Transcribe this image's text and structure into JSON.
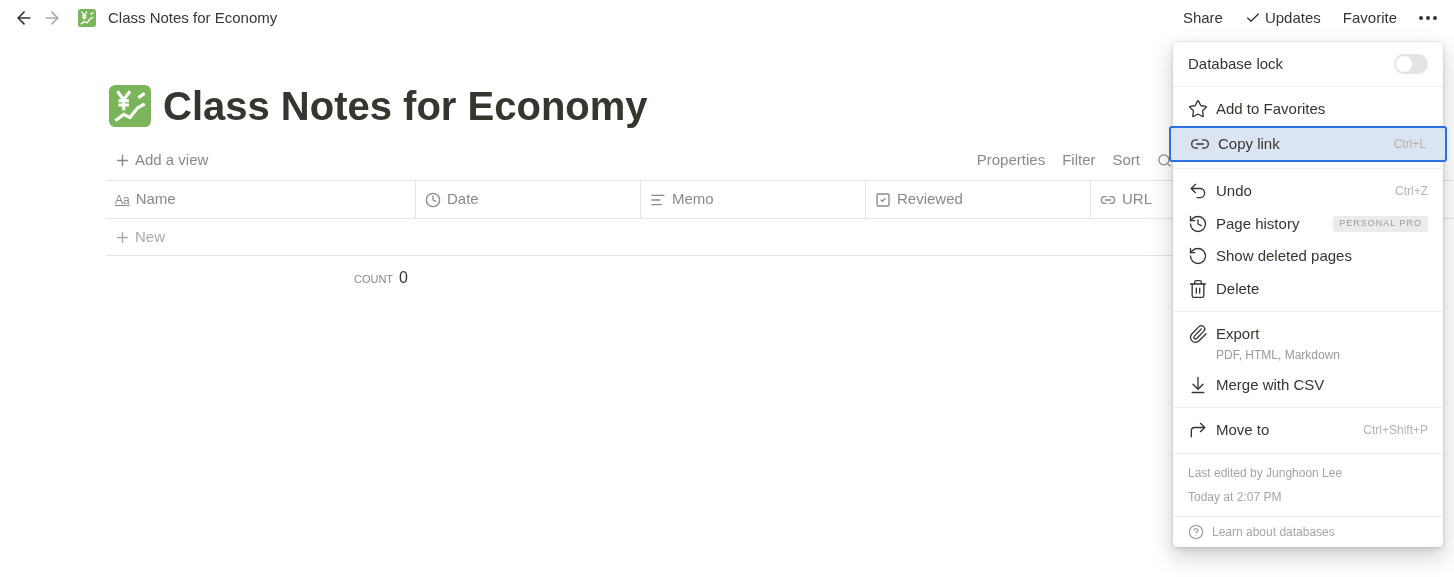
{
  "topbar": {
    "breadcrumb": "Class Notes for Economy",
    "actions": [
      {
        "label": "Share",
        "kind": "plain"
      },
      {
        "label": "Updates",
        "kind": "checked"
      },
      {
        "label": "Favorite",
        "kind": "plain"
      }
    ]
  },
  "page": {
    "title": "Class Notes for Economy",
    "add_view": "Add a view",
    "toolbar": [
      "Properties",
      "Filter",
      "Sort"
    ],
    "columns": [
      {
        "kind": "text",
        "glyph": "Aa",
        "label": "Name"
      },
      {
        "kind": "date",
        "label": "Date"
      },
      {
        "kind": "memo",
        "label": "Memo"
      },
      {
        "kind": "checkbox",
        "label": "Reviewed"
      },
      {
        "kind": "url",
        "label": "URL"
      }
    ],
    "new_row": "New",
    "count": {
      "label": "COUNT",
      "value": "0"
    }
  },
  "menu": {
    "database_lock": {
      "label": "Database lock",
      "on": false
    },
    "sections": [
      [
        {
          "kind": "star",
          "label": "Add to Favorites",
          "selected": false
        },
        {
          "kind": "link",
          "label": "Copy link",
          "shortcut": "Ctrl+L",
          "selected": true
        }
      ],
      [
        {
          "kind": "undo",
          "label": "Undo",
          "shortcut": "Ctrl+Z",
          "selected": false
        },
        {
          "kind": "history",
          "label": "Page history",
          "badge": "PERSONAL PRO",
          "selected": false
        },
        {
          "kind": "restore",
          "label": "Show deleted pages",
          "selected": false
        },
        {
          "kind": "trash",
          "label": "Delete",
          "selected": false
        }
      ],
      [
        {
          "kind": "export",
          "label": "Export",
          "subtitle": "PDF, HTML, Markdown",
          "selected": false
        },
        {
          "kind": "download",
          "label": "Merge with CSV",
          "selected": false
        }
      ],
      [
        {
          "kind": "move",
          "label": "Move to",
          "shortcut": "Ctrl+Shift+P",
          "selected": false
        }
      ]
    ],
    "footer": {
      "edited_by": "Last edited by Junghoon Lee",
      "edited_at": "Today at 2:07 PM"
    },
    "help": "Learn about databases"
  }
}
